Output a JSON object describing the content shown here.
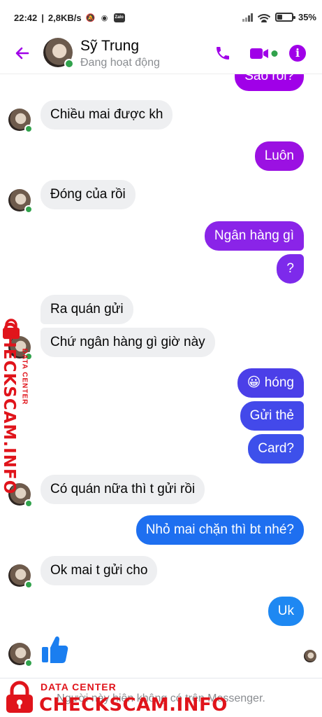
{
  "statusbar": {
    "time": "22:42",
    "network": "2,8KB/s",
    "zalo": "Zalo",
    "battery_text": "35%",
    "battery_level": 0.35
  },
  "header": {
    "name": "Sỹ Trung",
    "status": "Đang hoạt động",
    "accent": "#a000e8",
    "online_color": "#31a24c"
  },
  "messages": [
    {
      "dir": "out",
      "text": "Sao rồi?",
      "color": "#a000e8"
    },
    {
      "dir": "in",
      "text": "Chiều mai được kh",
      "avatar": true
    },
    {
      "dir": "out",
      "text": "Luôn",
      "color": "#9b11e2"
    },
    {
      "dir": "in",
      "text": "Đóng của rồi",
      "avatar": true
    },
    {
      "dir": "out",
      "text": "Ngân hàng gì",
      "color": "#8a24e8"
    },
    {
      "dir": "out",
      "text": "?",
      "color": "#7d2aeb"
    },
    {
      "dir": "in",
      "text": "Ra quán gửi",
      "avatar": false
    },
    {
      "dir": "in",
      "text": "Chứ ngân hàng gì giờ này",
      "avatar": true
    },
    {
      "dir": "out",
      "text": "😀 hóng",
      "color": "#4b3fe8"
    },
    {
      "dir": "out",
      "text": "Gửi thẻ",
      "color": "#4349ea"
    },
    {
      "dir": "out",
      "text": "Card?",
      "color": "#3d50eb"
    },
    {
      "dir": "in",
      "text": "Có quán nữa thì t gửi rồi",
      "avatar": true
    },
    {
      "dir": "out",
      "text": "Nhỏ mai chặn thì bt nhé?",
      "color": "#1e6ff0"
    },
    {
      "dir": "in",
      "text": "Ok mai t gửi cho",
      "avatar": true
    },
    {
      "dir": "out",
      "text": "Uk",
      "color": "#1e88f2"
    }
  ],
  "reaction": {
    "icon": "thumbs-up-icon",
    "color": "#1a7ef0"
  },
  "footer": {
    "notice": "Người này hiện không có trên Messenger."
  },
  "watermark": {
    "line1": "DATA CENTER",
    "line2": "CHECKSCAM.INFO",
    "color": "#e0141b"
  }
}
